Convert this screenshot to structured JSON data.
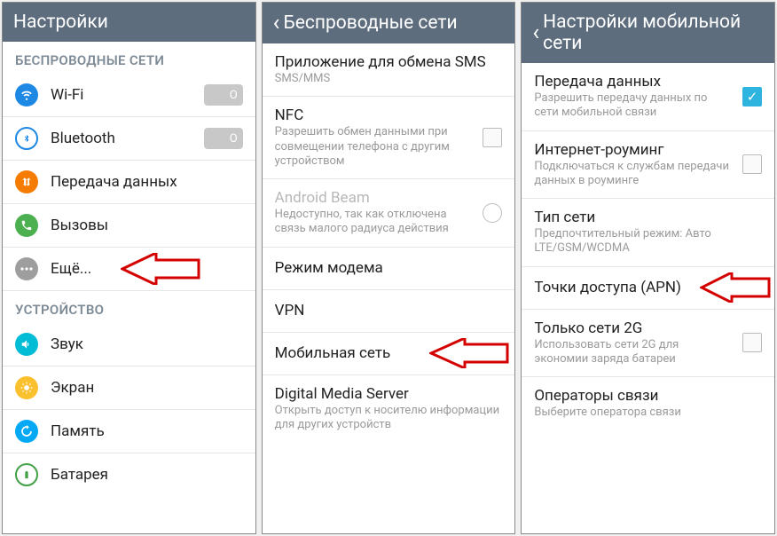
{
  "panel1": {
    "header": "Настройки",
    "section1": "БЕСПРОВОДНЫЕ СЕТИ",
    "wifi": "Wi-Fi",
    "wifi_toggle": "O",
    "bluetooth": "Bluetooth",
    "bt_toggle": "O",
    "data": "Передача данных",
    "calls": "Вызовы",
    "more": "Ещё...",
    "section2": "УСТРОЙСТВО",
    "sound": "Звук",
    "screen": "Экран",
    "memory": "Память",
    "battery": "Батарея"
  },
  "panel2": {
    "header": "Беспроводные сети",
    "sms_app": "Приложение для обмена SMS",
    "sms_sub": "SMS/MMS",
    "nfc": "NFC",
    "nfc_sub": "Разрешить обмен данными при совмещении телефона с другим устройством",
    "beam": "Android Beam",
    "beam_sub": "Недоступно, так как отключена связь малого радиуса действия",
    "tether": "Режим модема",
    "vpn": "VPN",
    "mobile": "Мобильная сеть",
    "dms": "Digital Media Server",
    "dms_sub": "Открыть доступ к носителю информации для других устройств"
  },
  "panel3": {
    "header": "Настройки мобильной сети",
    "data": "Передача данных",
    "data_sub": "Разрешить передачу данных по сети мобильной связи",
    "roaming": "Интернет-роуминг",
    "roaming_sub": "Подключаться к службам передачи данных в роуминге",
    "nettype": "Тип сети",
    "nettype_sub": "Предпочтительный режим: Авто LTE/GSM/WCDMA",
    "apn": "Точки доступа (APN)",
    "only2g": "Только сети 2G",
    "only2g_sub": "Использовать сети 2G для экономии заряда батареи",
    "operators": "Операторы связи",
    "operators_sub": "Выберите оператора связи"
  }
}
